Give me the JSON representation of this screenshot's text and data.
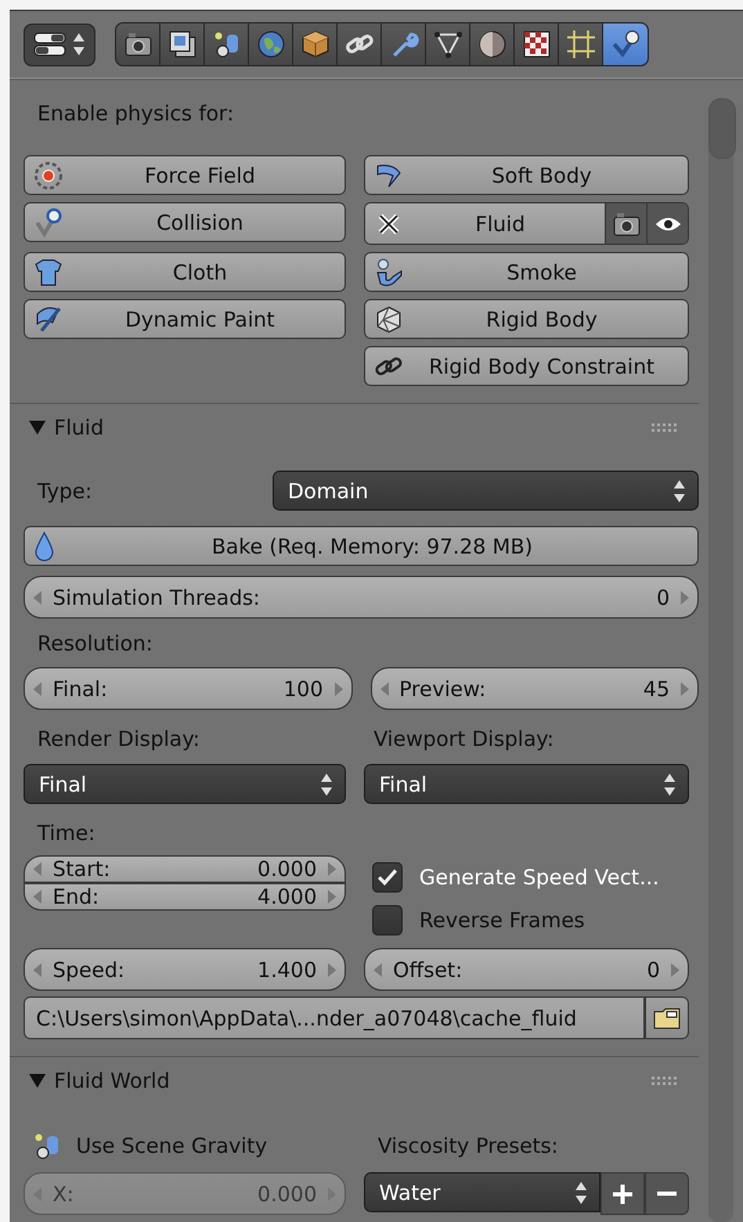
{
  "header": {
    "tabs": [
      {
        "kind": "camera",
        "selected": false
      },
      {
        "kind": "layers",
        "selected": false
      },
      {
        "kind": "scene",
        "selected": false
      },
      {
        "kind": "globe",
        "selected": false
      },
      {
        "kind": "cube",
        "selected": false
      },
      {
        "kind": "link",
        "selected": false
      },
      {
        "kind": "wrench",
        "selected": false
      },
      {
        "kind": "mesh",
        "selected": false
      },
      {
        "kind": "sphere",
        "selected": false
      },
      {
        "kind": "checker",
        "selected": false
      },
      {
        "kind": "sparkle",
        "selected": false
      },
      {
        "kind": "physics",
        "selected": true
      }
    ]
  },
  "enable_label": "Enable physics for:",
  "physics": [
    {
      "label": "Force Field",
      "kind": "field",
      "enabled": false
    },
    {
      "label": "Soft Body",
      "kind": "softbody",
      "enabled": false
    },
    {
      "label": "Collision",
      "kind": "collision",
      "enabled": false
    },
    {
      "label": "Fluid",
      "kind": "fluid",
      "enabled": true
    },
    {
      "label": "Cloth",
      "kind": "cloth",
      "enabled": false
    },
    {
      "label": "Smoke",
      "kind": "smoke",
      "enabled": false
    },
    {
      "label": "Dynamic Paint",
      "kind": "paint",
      "enabled": false
    },
    {
      "label": "Rigid Body",
      "kind": "rigid",
      "enabled": false
    },
    {
      "label": "Rigid Body Constraint",
      "kind": "constraint",
      "enabled": false
    }
  ],
  "fluid": {
    "title": "Fluid",
    "expanded": true,
    "type_label": "Type:",
    "type_value": "Domain",
    "bake": "Bake (Req. Memory: 97.28 MB)",
    "threads": {
      "label": "Simulation Threads:",
      "value": "0"
    },
    "resolution_label": "Resolution:",
    "final": {
      "label": "Final:",
      "value": "100"
    },
    "preview": {
      "label": "Preview:",
      "value": "45"
    },
    "render_display_label": "Render Display:",
    "render_display": "Final",
    "viewport_display_label": "Viewport Display:",
    "viewport_display": "Final",
    "time_label": "Time:",
    "start": {
      "label": "Start:",
      "value": "0.000"
    },
    "end": {
      "label": "End:",
      "value": "4.000"
    },
    "speed": {
      "label": "Speed:",
      "value": "1.400"
    },
    "offset": {
      "label": "Offset:",
      "value": "0"
    },
    "checks": [
      {
        "label": "Generate Speed Vect...",
        "checked": true
      },
      {
        "label": "Reverse Frames",
        "checked": false
      }
    ],
    "cache_path": "C:\\Users\\simon\\AppData\\...nder_a07048\\cache_fluid"
  },
  "fluid_world": {
    "title": "Fluid World",
    "expanded": true,
    "gravity_label": "Use Scene Gravity",
    "viscosity_label": "Viscosity Presets:",
    "x": {
      "label": "X:",
      "value": "0.000",
      "disabled": true
    },
    "preset": "Water"
  }
}
